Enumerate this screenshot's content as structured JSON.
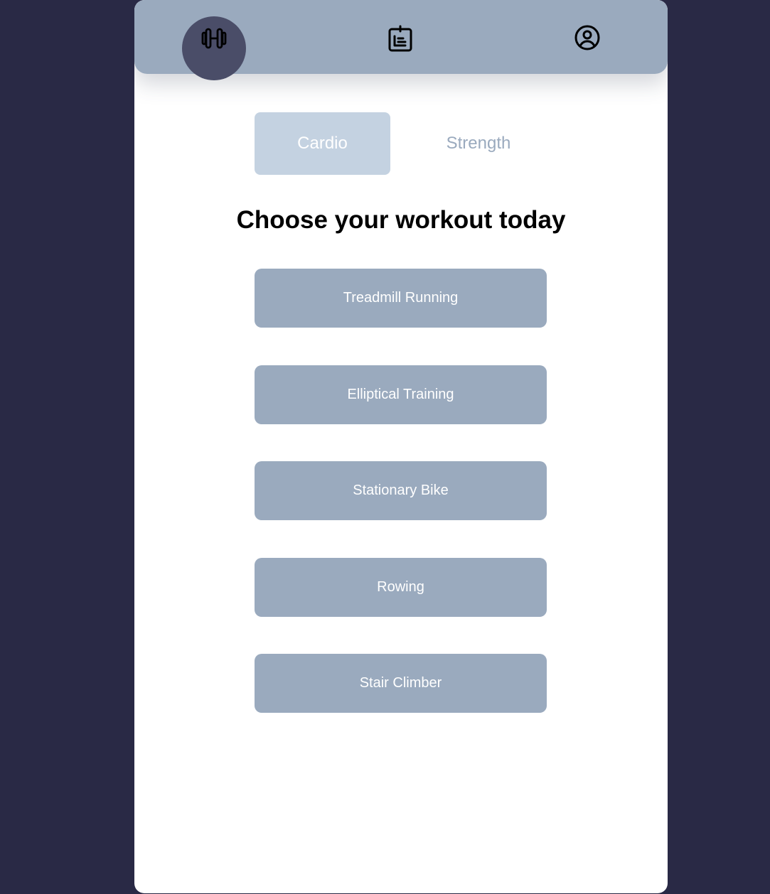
{
  "nav": {
    "items": [
      {
        "name": "workouts",
        "icon": "dumbbell-icon",
        "active": true
      },
      {
        "name": "log",
        "icon": "clipboard-list-icon",
        "active": false
      },
      {
        "name": "profile",
        "icon": "user-circle-icon",
        "active": false
      }
    ]
  },
  "tabs": [
    {
      "label": "Cardio",
      "active": true
    },
    {
      "label": "Strength",
      "active": false
    }
  ],
  "heading": "Choose your workout today",
  "workouts": [
    {
      "label": "Treadmill Running"
    },
    {
      "label": "Elliptical Training"
    },
    {
      "label": "Stationary Bike"
    },
    {
      "label": "Rowing"
    },
    {
      "label": "Stair Climber"
    }
  ],
  "colors": {
    "background": "#292945",
    "nav_bar": "#9aaabe",
    "active_nav": "#4a4d68",
    "active_tab": "#c4d2e1",
    "workout_button": "#9aaabe"
  }
}
